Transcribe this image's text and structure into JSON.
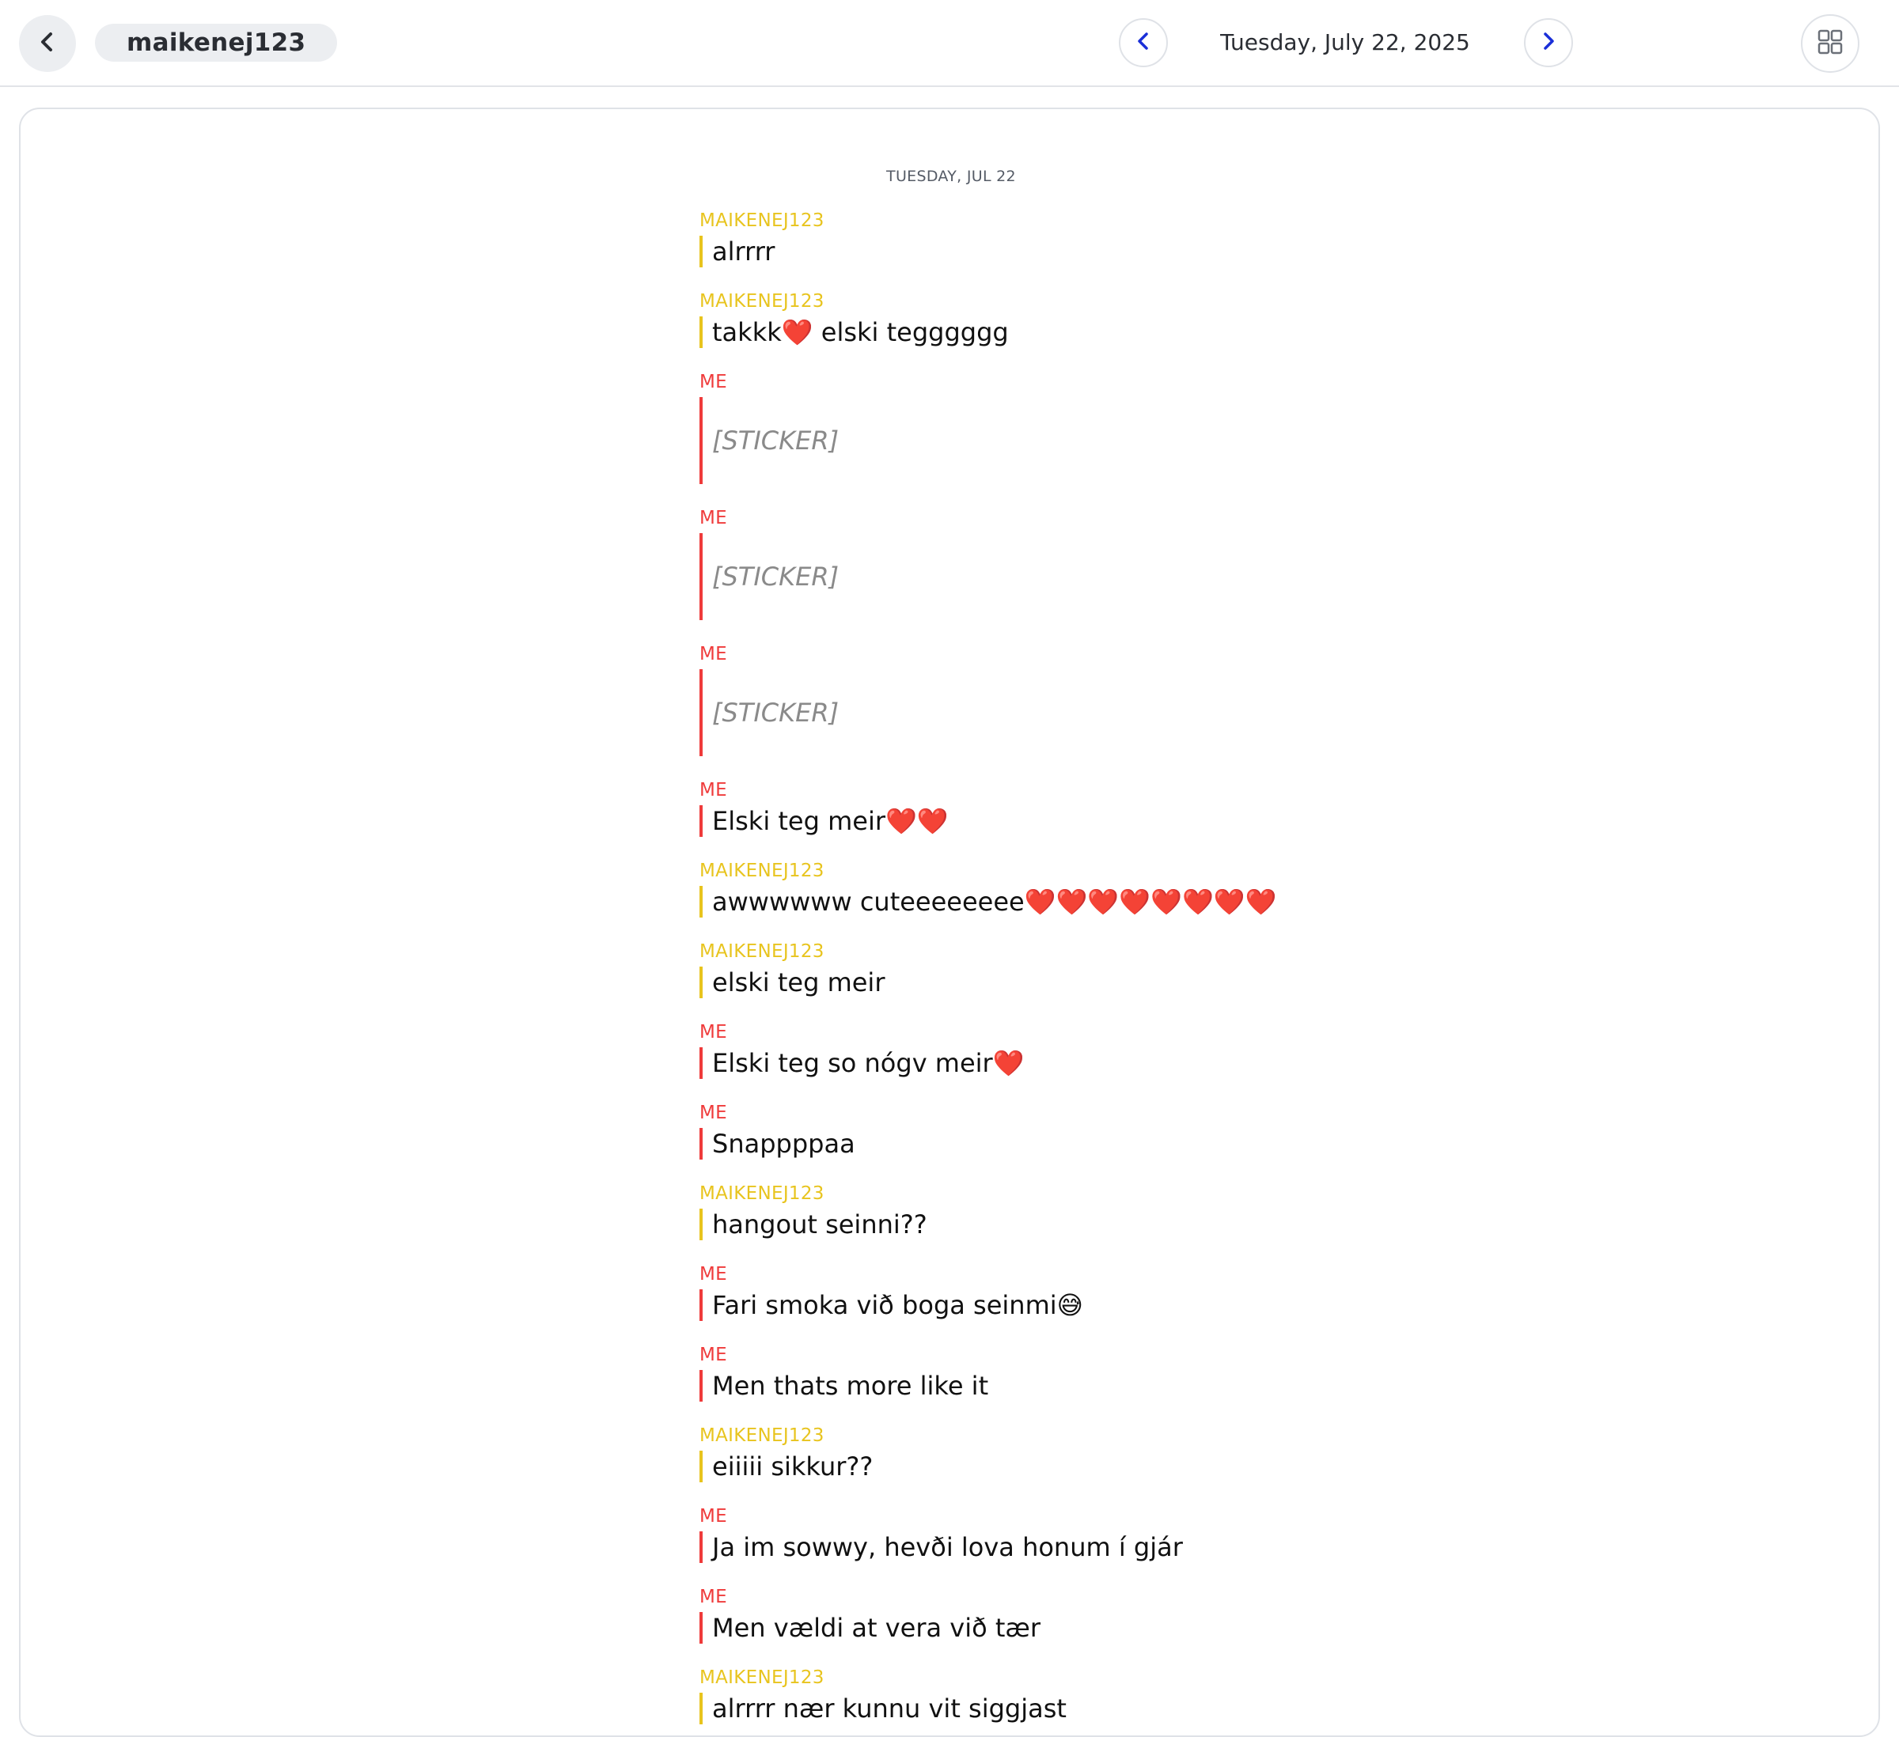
{
  "header": {
    "username": "maikenej123",
    "date": "Tuesday, July 22, 2025",
    "back_icon": "chevron-left-icon",
    "prev_icon": "chevron-left-icon",
    "next_icon": "chevron-right-icon",
    "grid_icon": "grid-icon"
  },
  "colors": {
    "me": "#ef3b3b",
    "them": "#e8c41e",
    "nav_arrow": "#1a2fd8"
  },
  "conversation": {
    "day_header": "TUESDAY, JUL 22",
    "messages": [
      {
        "sender": "MAIKENEJ123",
        "text": "alrrrr"
      },
      {
        "sender": "MAIKENEJ123",
        "text": "takkk❤️ elski tegggggg"
      },
      {
        "sender": "ME",
        "text": "[STICKER]"
      },
      {
        "sender": "ME",
        "text": "[STICKER]"
      },
      {
        "sender": "ME",
        "text": "[STICKER]"
      },
      {
        "sender": "ME",
        "text": "Elski teg meir❤️❤️"
      },
      {
        "sender": "MAIKENEJ123",
        "text": "awwwwww cuteeeeeeee❤️❤️❤️❤️❤️❤️❤️❤️"
      },
      {
        "sender": "MAIKENEJ123",
        "text": "elski teg meir"
      },
      {
        "sender": "ME",
        "text": "Elski teg so nógv meir❤️"
      },
      {
        "sender": "ME",
        "text": "Snappppaa"
      },
      {
        "sender": "MAIKENEJ123",
        "text": "hangout seinni??"
      },
      {
        "sender": "ME",
        "text": "Fari smoka við boga seinmi😅"
      },
      {
        "sender": "ME",
        "text": "Men thats more like it"
      },
      {
        "sender": "MAIKENEJ123",
        "text": "eiiiii sikkur??"
      },
      {
        "sender": "ME",
        "text": "Ja im sowwy, hevði lova honum í gjár"
      },
      {
        "sender": "ME",
        "text": "Men vældi at vera við tær"
      },
      {
        "sender": "MAIKENEJ123",
        "text": "alrrrr nær kunnu vit siggjast"
      }
    ]
  }
}
